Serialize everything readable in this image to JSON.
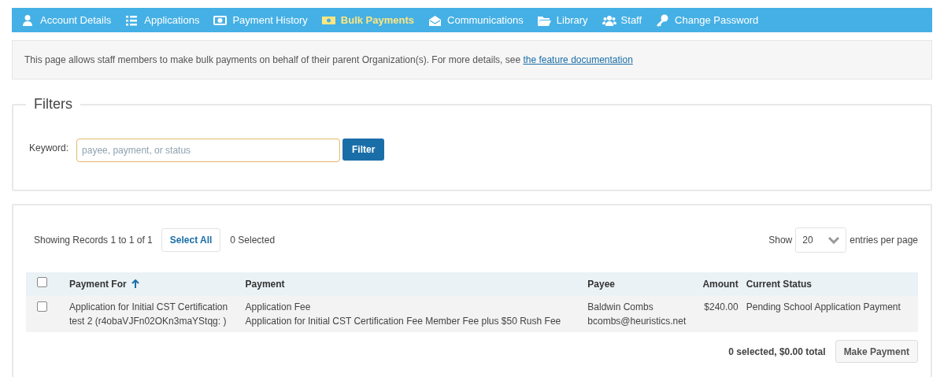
{
  "nav": [
    {
      "label": "Account Details",
      "selected": false
    },
    {
      "label": "Applications",
      "selected": false
    },
    {
      "label": "Payment History",
      "selected": false
    },
    {
      "label": "Bulk Payments",
      "selected": true
    },
    {
      "label": "Communications",
      "selected": false
    },
    {
      "label": "Library",
      "selected": false
    },
    {
      "label": "Staff",
      "selected": false
    },
    {
      "label": "Change Password",
      "selected": false
    }
  ],
  "info": {
    "text": "This page allows staff members to make bulk payments on behalf of their parent Organization(s). For more details, see",
    "link": "the feature documentation"
  },
  "filters": {
    "title": "Filters",
    "keyword_label": "Keyword:",
    "placeholder": "payee, payment, or status",
    "button": "Filter"
  },
  "results": {
    "showing": "Showing Records 1 to 1 of 1",
    "select_all": "Select All",
    "selected_count": "0 Selected",
    "show_label": "Show",
    "page_size": "20",
    "per_page_label": "entries per page",
    "header_checked": false,
    "columns": [
      {
        "label": "Payment For",
        "sorted": true
      },
      {
        "label": "Payment",
        "sorted": false
      },
      {
        "label": "Payee",
        "sorted": false
      },
      {
        "label": "Amount",
        "sorted": false
      },
      {
        "label": "Current Status",
        "sorted": false
      }
    ],
    "rows": [
      {
        "checked": false,
        "payment_for": [
          "Application for Initial CST Certification",
          "test 2 (r4obaVJFn02OKn3maYStqg: )"
        ],
        "payment": [
          "Application Fee",
          "Application for Initial CST Certification Fee Member Fee plus $50 Rush Fee"
        ],
        "payee": [
          "Baldwin Combs",
          "bcombs@heuristics.net"
        ],
        "amount": "$240.00",
        "status": "Pending School Application Payment"
      }
    ],
    "total": "0 selected, $0.00 total",
    "make_payment": "Make Payment"
  }
}
